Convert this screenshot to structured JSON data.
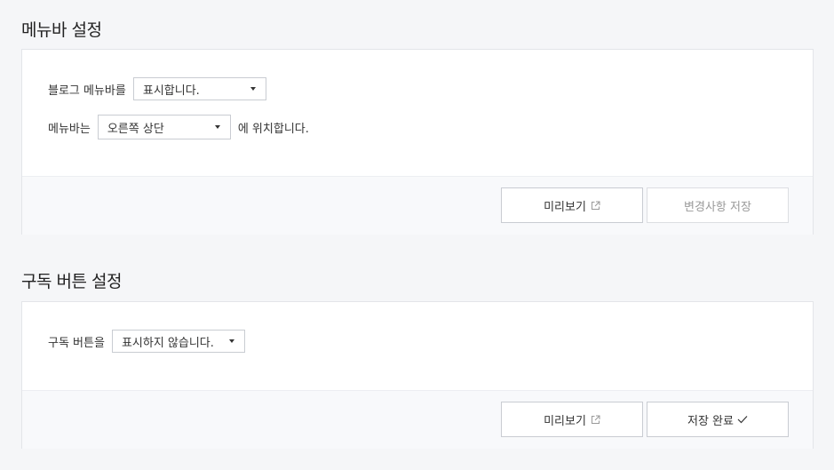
{
  "menubar": {
    "title": "메뉴바 설정",
    "row1_label": "블로그 메뉴바를",
    "row1_select": "표시합니다.",
    "row2_label": "메뉴바는",
    "row2_select": "오른쪽 상단",
    "row2_suffix": "에 위치합니다.",
    "preview_label": "미리보기",
    "save_label": "변경사항 저장"
  },
  "subscribe": {
    "title": "구독 버튼 설정",
    "row1_label": "구독 버튼을",
    "row1_select": "표시하지 않습니다.",
    "preview_label": "미리보기",
    "save_label": "저장 완료"
  },
  "icons": {
    "external": "external-link-icon",
    "check": "check-icon",
    "caret": "caret-down-icon"
  }
}
